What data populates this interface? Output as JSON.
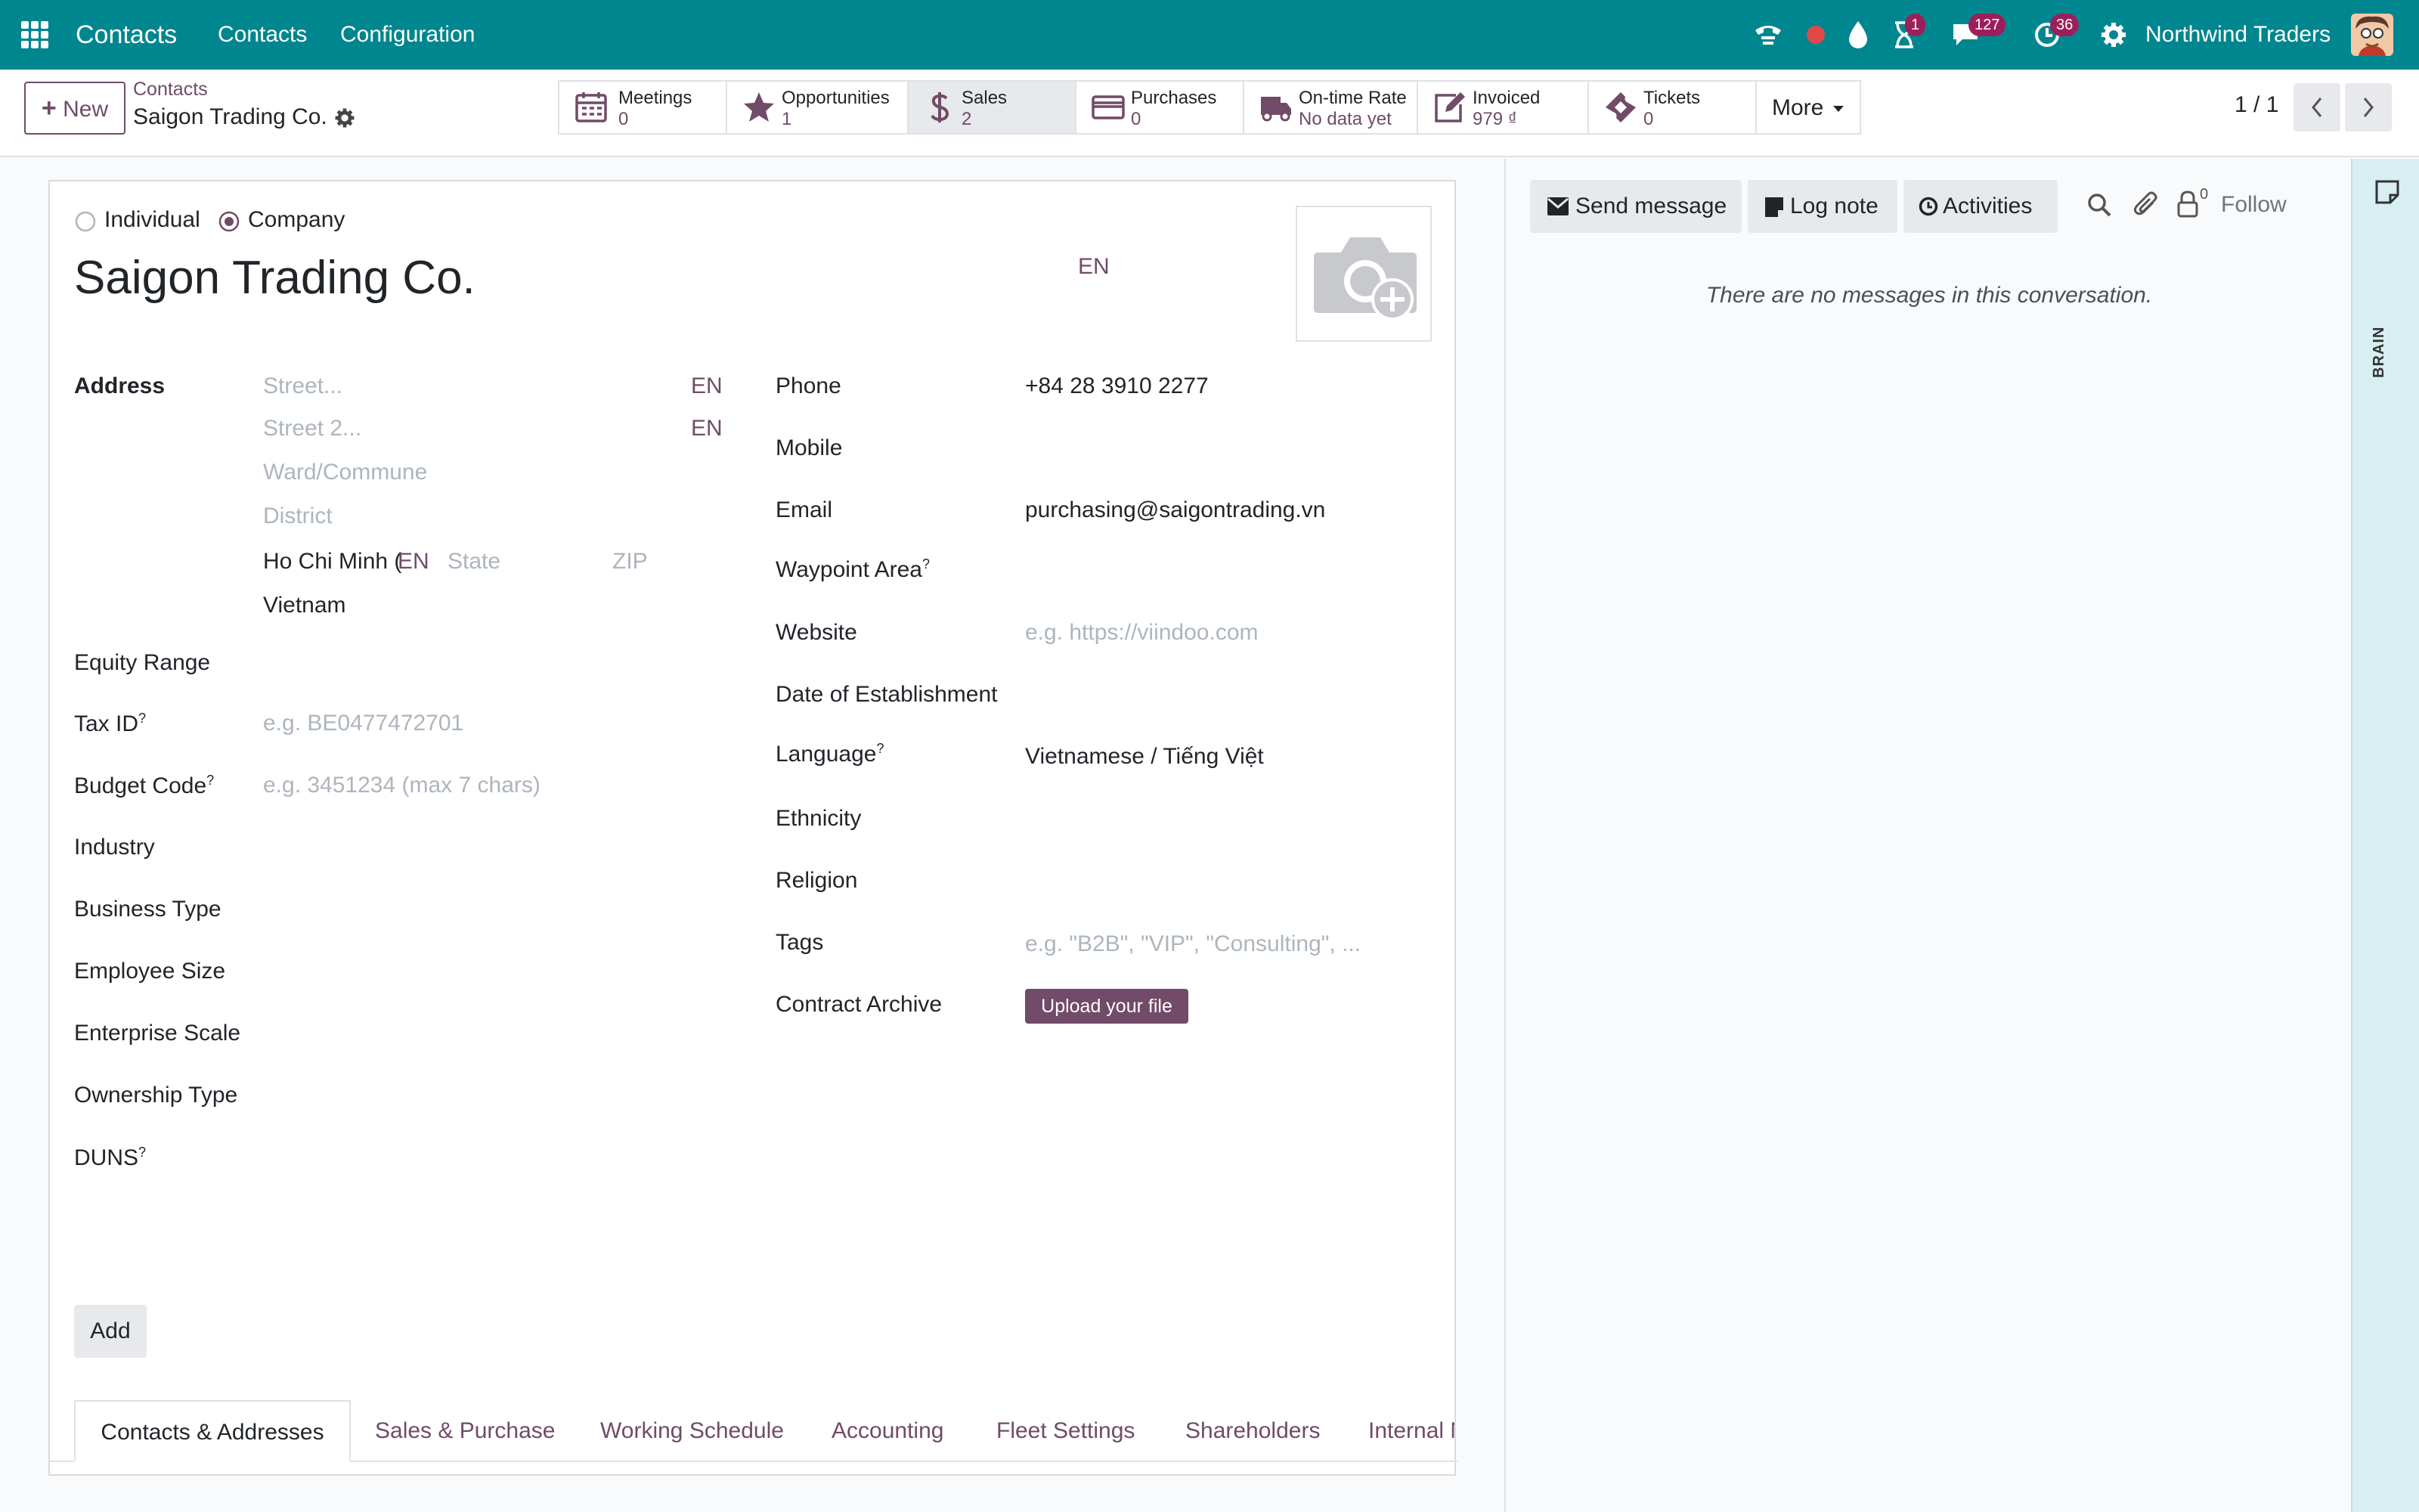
{
  "navbar": {
    "app_name": "Contacts",
    "menu": [
      "Contacts",
      "Configuration"
    ],
    "activity_badge": "1",
    "messages_badge": "127",
    "clock_badge": "36",
    "company": "Northwind Traders",
    "icons": [
      "apps-grid-icon",
      "phone-icon",
      "record-dot-icon",
      "drop-icon",
      "hourglass-icon",
      "chat-icon",
      "clock-icon",
      "settings-icon",
      "avatar"
    ]
  },
  "control_panel": {
    "new_label": "New",
    "breadcrumb_parent": "Contacts",
    "record_title": "Saigon Trading Co.",
    "pager": "1 / 1",
    "more_label": "More",
    "smart_buttons": [
      {
        "label": "Meetings",
        "value": "0",
        "icon": "calendar-icon"
      },
      {
        "label": "Opportunities",
        "value": "1",
        "icon": "star-icon"
      },
      {
        "label": "Sales",
        "value": "2",
        "icon": "dollar-icon"
      },
      {
        "label": "Purchases",
        "value": "0",
        "icon": "credit-card-icon"
      },
      {
        "label": "On-time Rate",
        "value": "No data yet",
        "icon": "truck-icon"
      },
      {
        "label": "Invoiced",
        "value": "979 ₫",
        "icon": "pencil-square-icon"
      },
      {
        "label": "Tickets",
        "value": "0",
        "icon": "ticket-icon"
      }
    ]
  },
  "form": {
    "type_individual": "Individual",
    "type_company": "Company",
    "company_type_selected": "Company",
    "name": "Saigon Trading Co.",
    "lang_badge": "EN",
    "address": {
      "label": "Address",
      "street_placeholder": "Street...",
      "street2_placeholder": "Street 2...",
      "ward_placeholder": "Ward/Commune",
      "district_placeholder": "District",
      "city": "Ho Chi Minh (",
      "city_lang": "EN",
      "state_placeholder": "State",
      "zip_placeholder": "ZIP",
      "country": "Vietnam",
      "street_lang": "EN",
      "street2_lang": "EN"
    },
    "left_fields": {
      "equity_range": "Equity Range",
      "tax_id": "Tax ID",
      "tax_id_placeholder": "e.g. BE0477472701",
      "budget_code": "Budget Code",
      "budget_code_placeholder": "e.g. 3451234 (max 7 chars)",
      "industry": "Industry",
      "business_type": "Business Type",
      "employee_size": "Employee Size",
      "enterprise_scale": "Enterprise Scale",
      "ownership_type": "Ownership Type",
      "duns": "DUNS"
    },
    "right_fields": {
      "phone_label": "Phone",
      "phone": "+84 28 3910 2277",
      "mobile_label": "Mobile",
      "email_label": "Email",
      "email": "purchasing@saigontrading.vn",
      "waypoint_label": "Waypoint Area",
      "website_label": "Website",
      "website_placeholder": "e.g. https://viindoo.com",
      "doe_label": "Date of Establishment",
      "language_label": "Language",
      "language": "Vietnamese / Tiếng Việt",
      "ethnicity_label": "Ethnicity",
      "religion_label": "Religion",
      "tags_label": "Tags",
      "tags_placeholder": "e.g. \"B2B\", \"VIP\", \"Consulting\", ...",
      "contract_label": "Contract Archive",
      "upload_label": "Upload your file"
    },
    "help_mark": "?",
    "tabs": [
      "Contacts & Addresses",
      "Sales & Purchase",
      "Working Schedule",
      "Accounting",
      "Fleet Settings",
      "Shareholders",
      "Internal N"
    ],
    "add_label": "Add"
  },
  "chatter": {
    "send_message": "Send message",
    "log_note": "Log note",
    "activities": "Activities",
    "follower_count": "0",
    "follow": "Follow",
    "empty": "There are no messages in this conversation."
  },
  "sidepanel": {
    "label": "BRAIN"
  },
  "colors": {
    "navbar": "#00868f",
    "accent": "#714b67",
    "badge": "#9c1f5a",
    "record_dot": "#e04848"
  }
}
